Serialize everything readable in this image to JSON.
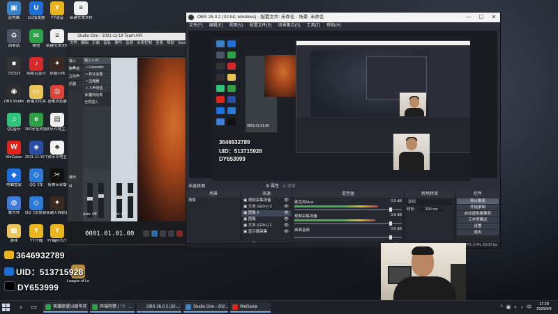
{
  "desktop": {
    "icons": [
      {
        "label": "此电脑",
        "glyph": "▣",
        "color": "#3b83c6"
      },
      {
        "label": "UU加速器",
        "glyph": "U",
        "color": "#1f6fd6"
      },
      {
        "label": "YY语音",
        "glyph": "Y",
        "color": "#e9b51e"
      },
      {
        "label": "新建文本文档 889164ce7...(2)",
        "glyph": "≡",
        "color": "#f0f0f0"
      },
      {
        "label": "回收站",
        "glyph": "♻",
        "color": "#4b5563"
      },
      {
        "label": "微信",
        "glyph": "✉",
        "color": "#2ba245"
      },
      {
        "label": "新建文本文档",
        "glyph": "≡",
        "color": "#f0f0f0"
      },
      {
        "label": "232323",
        "glyph": "■",
        "color": "#333"
      },
      {
        "label": "网易云音乐",
        "glyph": "♪",
        "color": "#d42a2a"
      },
      {
        "label": "穿越火线",
        "glyph": "✦",
        "color": "#3a2a22"
      },
      {
        "label": "OBS Studio",
        "glyph": "◉",
        "color": "#302e31"
      },
      {
        "label": "新建文件夹",
        "glyph": "▭",
        "color": "#e8c35a"
      },
      {
        "label": "谷歌浏览器",
        "glyph": "◎",
        "color": "#db4437"
      },
      {
        "label": "QQ音乐",
        "glyph": "♫",
        "color": "#31c27c"
      },
      {
        "label": "360安全浏览器",
        "glyph": "e",
        "color": "#2f9e44"
      },
      {
        "label": "欢乐斗地主 - 天天乐",
        "glyph": "▤",
        "color": "#f0f0f0"
      },
      {
        "label": "WeGame",
        "glyph": "W",
        "color": "#e0241b"
      },
      {
        "label": "2021-11-19 Team AIR...",
        "glyph": "◈",
        "color": "#2a4fa0"
      },
      {
        "label": "欢乐斗地主",
        "glyph": "♣",
        "color": "#f3f3f3"
      },
      {
        "label": "电脑管家",
        "glyph": "◆",
        "color": "#1d6fe0"
      },
      {
        "label": "QQ飞车",
        "glyph": "◇",
        "color": "#2d7bd6"
      },
      {
        "label": "剪映专业版",
        "glyph": "✂",
        "color": "#111"
      },
      {
        "label": "鲁大师",
        "glyph": "◍",
        "color": "#3f7bd8"
      },
      {
        "label": "QQ飞车修复工具",
        "glyph": "◇",
        "color": "#2d7bd6"
      },
      {
        "label": "穿越火线修复4工具",
        "glyph": "✦",
        "color": "#3a2a22"
      },
      {
        "label": "游戏",
        "glyph": "▦",
        "color": "#e8c35a"
      },
      {
        "label": "YY开播",
        "glyph": "Y",
        "color": "#e9b51e"
      },
      {
        "label": "YY福利大厅",
        "glyph": "Y",
        "color": "#e9b51e"
      },
      {
        "label": "League of Legends",
        "glyph": "⚔",
        "color": "#b48a3c"
      }
    ],
    "overlay_lines": [
      {
        "text": "3646932789",
        "color": "#e9b51e"
      },
      {
        "text": "UID：513715928",
        "color": "#1f6fd6"
      },
      {
        "text": "DY653999",
        "color": "#000000"
      }
    ]
  },
  "studio": {
    "title": "Studio One - 2021-11-19 Team AIR",
    "menu": [
      "文件",
      "编辑",
      "乐曲",
      "音轨",
      "事件",
      "音频",
      "合宿控制",
      "查看",
      "帮助",
      "Studio"
    ],
    "left_items": [
      "输入 L+R",
      "单声道",
      "立体声",
      "乐器"
    ],
    "insert_header": "输入 L+R",
    "insert_items": [
      "+ Expander",
      "+ 默认设置",
      "+ 压缩器",
      "+ 人声增强",
      "+ 混响效果"
    ],
    "channel_labels": [
      "输出",
      "M",
      "Auto: Off",
      "Auto: Off"
    ],
    "insert_labels": [
      "实况",
      "全局插入"
    ],
    "time": "0001.01.01.00"
  },
  "obs": {
    "title": "OBS 26.0.2 (32-bit, windows) - 配置文件: 未命名 - 场景: 未命名",
    "menu": [
      "文件(F)",
      "编辑(E)",
      "视图(V)",
      "配置文件(P)",
      "场景集合(S)",
      "工具(T)",
      "帮助(H)"
    ],
    "no_source": "未选择源",
    "props_label": "⚙ 属性",
    "filters_label": "⛭ 滤镜",
    "dock_titles": [
      "场景",
      "来源",
      "混音器",
      "转场特效",
      "控件"
    ],
    "scenes": [
      "场景"
    ],
    "sources": [
      {
        "label": "视频采集设备",
        "selected": false
      },
      {
        "label": "文本 (GDI+) 3",
        "selected": false
      },
      {
        "label": "图像 2",
        "selected": true
      },
      {
        "label": "图像",
        "selected": false
      },
      {
        "label": "文本 (GDI+) 2",
        "selected": false
      },
      {
        "label": "显示器采集",
        "selected": false
      }
    ],
    "mixer": [
      {
        "name": "麦克风/Aux",
        "db": "0.0 dB",
        "level": 0.78
      },
      {
        "name": "视频采集设备",
        "db": "0.0 dB",
        "level": 0.75
      },
      {
        "name": "桌面音频",
        "db": "0.0 dB",
        "level": 0.0
      }
    ],
    "transition": {
      "type": "淡出",
      "duration_label": "时长",
      "duration": "300 ms"
    },
    "controls": [
      {
        "label": "停止推流",
        "active": true
      },
      {
        "label": "开始录制",
        "active": false
      },
      {
        "label": "启动虚拟摄像机",
        "active": false
      },
      {
        "label": "工作室模式",
        "active": false
      },
      {
        "label": "设置",
        "active": false
      },
      {
        "label": "退出",
        "active": false
      }
    ],
    "status": "丢帧 0 (0.0%)   LIVE: 00:00:00   REC: 00:00:00   CPU: 3.4%, 60.00 fps",
    "preview_overlay": [
      "3646932789",
      "UID：513715928",
      "DY653999"
    ],
    "preview_time": "0001.01.01.00"
  },
  "taskbar": {
    "apps": [
      {
        "label": "英雄联盟18周年庆",
        "color": "#2ba245"
      },
      {
        "label": "异端狩猎 ( '-'） ...",
        "color": "#2ba245"
      },
      {
        "label": "OBS 26.0.2 (32-...",
        "color": "#302e31"
      },
      {
        "label": "Studio One - 202...",
        "color": "#3b83c6"
      },
      {
        "label": "WeGame",
        "color": "#e0241b"
      }
    ],
    "tray": [
      "^",
      "▣",
      "◐",
      "♪",
      "中"
    ],
    "clock_time": "17:29",
    "clock_date": "2025/9/8"
  }
}
